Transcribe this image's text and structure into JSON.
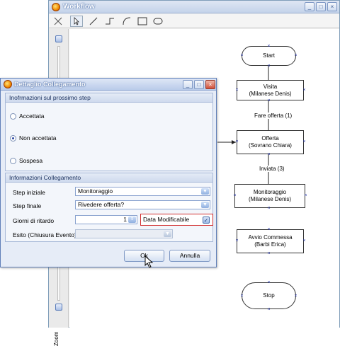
{
  "workflow": {
    "title": "Workflow",
    "title_buttons": [
      "_",
      "□",
      "×"
    ],
    "tools": [
      "cross-tool",
      "pointer-tool",
      "line-tool",
      "step-line-tool",
      "arc-tool",
      "rectangle-tool",
      "ellipse-tool"
    ],
    "zoom_label": "Zoom",
    "nodes": [
      {
        "line1": "Start",
        "line2": ""
      },
      {
        "line1": "Visita",
        "line2": "(Milanese Denis)"
      },
      {
        "line1": "Offerta",
        "line2": "(Sovrano Chiara)"
      },
      {
        "line1": "Monitoraggio",
        "line2": "(Milanese Denis)"
      },
      {
        "line1": "Avvio Commessa",
        "line2": "(Barbi Erica)"
      },
      {
        "line1": "Stop",
        "line2": ""
      }
    ],
    "edge_labels": [
      "Fare offerta (1)",
      "Inviata (3)"
    ]
  },
  "dialog": {
    "title": "Dettaglio Collegamento",
    "title_buttons": [
      "_",
      "□",
      "×"
    ],
    "group1_title": "Inofrmazioni sul prossimo step",
    "radios": [
      {
        "label": "Accettata",
        "checked": false
      },
      {
        "label": "Non accettata",
        "checked": true
      },
      {
        "label": "Sospesa",
        "checked": false
      }
    ],
    "group2_title": "Informazioni Collegamento",
    "step_iniziale_label": "Step iniziale",
    "step_iniziale_value": "Monitoraggio",
    "step_finale_label": "Step finale",
    "step_finale_value": "Rivedere offerta?",
    "giorni_label": "Giorni di ritardo",
    "giorni_value": "1",
    "data_modificabile_label": "Data Modificabile",
    "data_modificabile_checked": true,
    "esito_label": "Esito (Chiusura Evento)",
    "esito_value": "",
    "ok_label": "Ok",
    "annulla_label": "Annulla"
  }
}
